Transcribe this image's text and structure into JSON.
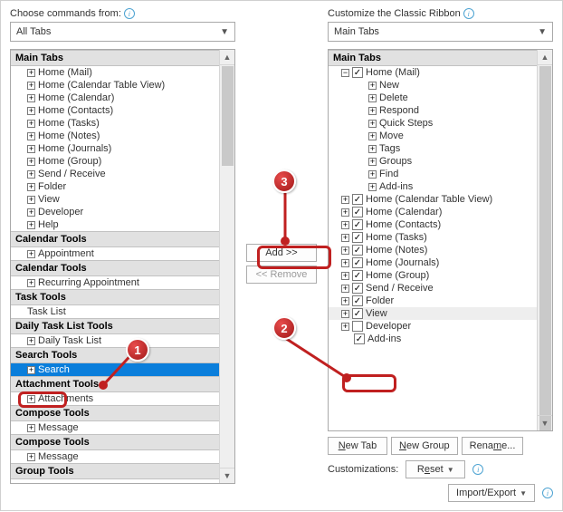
{
  "left": {
    "label": "Choose commands from:",
    "dropdown": "All Tabs",
    "header": "Main Tabs",
    "items": [
      {
        "e": "+",
        "t": "Home (Mail)"
      },
      {
        "e": "+",
        "t": "Home (Calendar Table View)"
      },
      {
        "e": "+",
        "t": "Home (Calendar)"
      },
      {
        "e": "+",
        "t": "Home (Contacts)"
      },
      {
        "e": "+",
        "t": "Home (Tasks)"
      },
      {
        "e": "+",
        "t": "Home (Notes)"
      },
      {
        "e": "+",
        "t": "Home (Journals)"
      },
      {
        "e": "+",
        "t": "Home (Group)"
      },
      {
        "e": "+",
        "t": "Send / Receive"
      },
      {
        "e": "+",
        "t": "Folder"
      },
      {
        "e": "+",
        "t": "View"
      },
      {
        "e": "+",
        "t": "Developer"
      },
      {
        "e": "+",
        "t": "Help"
      }
    ],
    "groups": [
      {
        "h": "Calendar Tools",
        "items": [
          {
            "e": "+",
            "t": "Appointment"
          }
        ]
      },
      {
        "h": "Calendar Tools",
        "items": [
          {
            "e": "+",
            "t": "Recurring Appointment"
          }
        ]
      },
      {
        "h": "Task Tools",
        "items": [
          {
            "e": "",
            "t": "Task List"
          }
        ]
      },
      {
        "h": "Daily Task List Tools",
        "items": [
          {
            "e": "+",
            "t": "Daily Task List"
          }
        ]
      },
      {
        "h": "Search Tools",
        "items": [
          {
            "e": "+",
            "t": "Search",
            "sel": true
          }
        ]
      },
      {
        "h": "Attachment Tools",
        "items": [
          {
            "e": "+",
            "t": "Attachments"
          }
        ]
      },
      {
        "h": "Compose Tools",
        "items": [
          {
            "e": "+",
            "t": "Message"
          }
        ]
      },
      {
        "h": "Compose Tools",
        "items": [
          {
            "e": "+",
            "t": "Message"
          }
        ]
      },
      {
        "h": "Group Tools",
        "items": []
      }
    ]
  },
  "right": {
    "label": "Customize the Classic Ribbon",
    "dropdown": "Main Tabs",
    "header": "Main Tabs",
    "tree": [
      {
        "e": "-",
        "c": true,
        "t": "Home (Mail)",
        "children": [
          {
            "e": "+",
            "t": "New"
          },
          {
            "e": "+",
            "t": "Delete"
          },
          {
            "e": "+",
            "t": "Respond"
          },
          {
            "e": "+",
            "t": "Quick Steps"
          },
          {
            "e": "+",
            "t": "Move"
          },
          {
            "e": "+",
            "t": "Tags"
          },
          {
            "e": "+",
            "t": "Groups"
          },
          {
            "e": "+",
            "t": "Find"
          },
          {
            "e": "+",
            "t": "Add-ins"
          }
        ]
      },
      {
        "e": "+",
        "c": true,
        "t": "Home (Calendar Table View)"
      },
      {
        "e": "+",
        "c": true,
        "t": "Home (Calendar)"
      },
      {
        "e": "+",
        "c": true,
        "t": "Home (Contacts)"
      },
      {
        "e": "+",
        "c": true,
        "t": "Home (Tasks)"
      },
      {
        "e": "+",
        "c": true,
        "t": "Home (Notes)"
      },
      {
        "e": "+",
        "c": true,
        "t": "Home (Journals)"
      },
      {
        "e": "+",
        "c": true,
        "t": "Home (Group)"
      },
      {
        "e": "+",
        "c": true,
        "t": "Send / Receive"
      },
      {
        "e": "+",
        "c": true,
        "t": "Folder"
      },
      {
        "e": "+",
        "c": true,
        "t": "View",
        "hl": true
      },
      {
        "e": "+",
        "c": false,
        "t": "Developer"
      },
      {
        "e": "",
        "c": true,
        "t": "Add-ins"
      }
    ],
    "buttons": {
      "newtab": "New Tab",
      "newgroup": "New Group",
      "rename": "Rename..."
    },
    "resetLabel": "Customizations:",
    "reset": "Reset",
    "importExport": "Import/Export"
  },
  "middle": {
    "add": "Add >>",
    "remove": "<< Remove"
  },
  "callouts": {
    "n1": "1",
    "n2": "2",
    "n3": "3"
  }
}
